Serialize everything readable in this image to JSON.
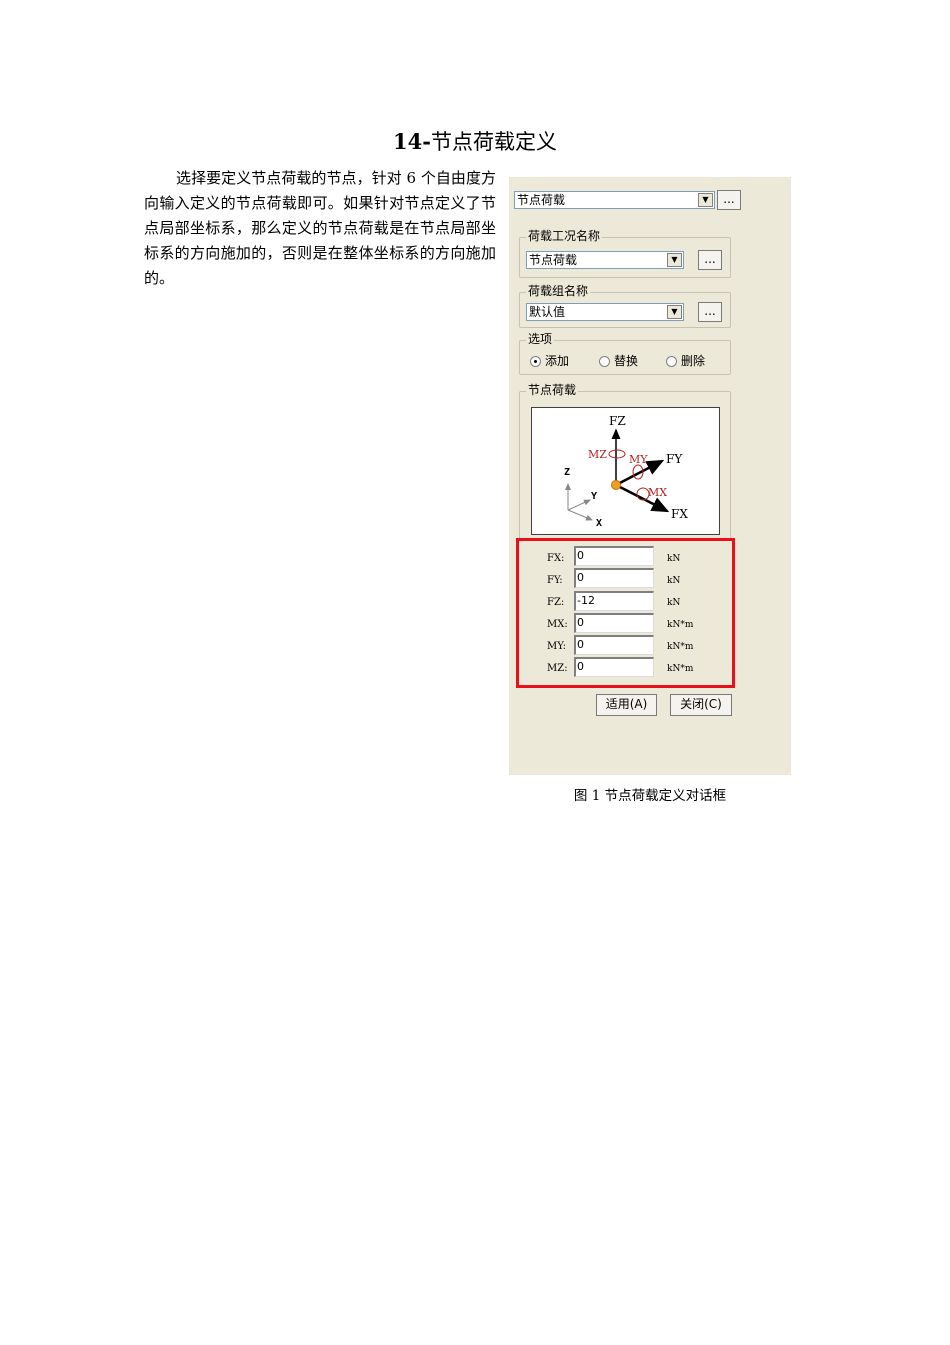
{
  "doc": {
    "title_num": "14-",
    "title_text": "节点荷载定义",
    "para": "选择要定义节点荷载的节点，针对 6 个自由度方向输入定义的节点荷载即可。如果针对节点定义了节点局部坐标系，那么定义的节点荷载是在节点局部坐标系的方向施加的，否则是在整体坐标系的方向施加的。",
    "caption": "图 1  节点荷载定义对话框"
  },
  "dialog": {
    "top_combo": "节点荷载",
    "dots": "...",
    "load_case": {
      "label": "荷载工况名称",
      "value": "节点荷载"
    },
    "load_group": {
      "label": "荷载组名称",
      "value": "默认值"
    },
    "options": {
      "label": "选项",
      "items": [
        {
          "label": "添加",
          "selected": true
        },
        {
          "label": "替换",
          "selected": false
        },
        {
          "label": "删除",
          "selected": false
        }
      ]
    },
    "node_load_label": "节点荷载",
    "diagram": {
      "fz": "FZ",
      "fy": "FY",
      "fx": "FX",
      "mz": "MZ",
      "my": "MY",
      "mx": "MX",
      "z": "Z",
      "y": "Y",
      "x": "X"
    },
    "fields": [
      {
        "label": "FX:",
        "value": "0",
        "unit": "kN"
      },
      {
        "label": "FY:",
        "value": "0",
        "unit": "kN"
      },
      {
        "label": "FZ:",
        "value": "-12",
        "unit": "kN"
      },
      {
        "label": "MX:",
        "value": "0",
        "unit": "kN*m"
      },
      {
        "label": "MY:",
        "value": "0",
        "unit": "kN*m"
      },
      {
        "label": "MZ:",
        "value": "0",
        "unit": "kN*m"
      }
    ],
    "apply_button": "适用(A)",
    "close_button": "关闭(C)"
  },
  "colors": {
    "dialog_bg": "#ece9d8",
    "highlight_box": "#e8101a",
    "moment_red": "#b22222"
  }
}
